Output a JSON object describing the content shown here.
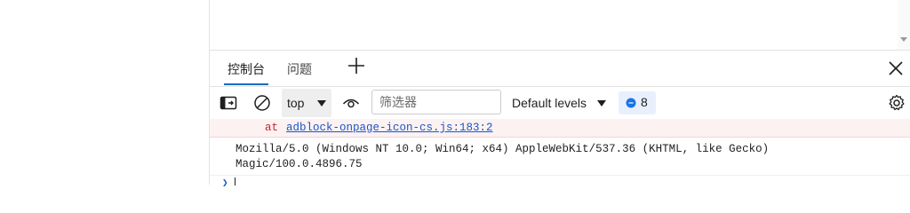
{
  "devtools": {
    "tabs": [
      {
        "label": "控制台",
        "active": true
      },
      {
        "label": "问题",
        "active": false
      }
    ],
    "add_tab_icon": "plus-icon",
    "close_icon": "close-icon"
  },
  "toolbar": {
    "context": "top",
    "filter_placeholder": "筛选器",
    "levels": "Default levels",
    "issues_count": "8"
  },
  "console": {
    "error_at": "at",
    "error_link": "adblock-onpage-icon-cs.js:183:2",
    "log_line_1": "Mozilla/5.0 (Windows NT 10.0; Win64; x64) AppleWebKit/537.36 (KHTML, like Gecko)",
    "log_line_2": "Magic/100.0.4896.75"
  },
  "colors": {
    "accent": "#0f6cbd",
    "error_text": "#c8232c",
    "error_bg": "#fdf2f2",
    "link": "#1a55c8",
    "badge_bg": "#e8f0fe"
  }
}
